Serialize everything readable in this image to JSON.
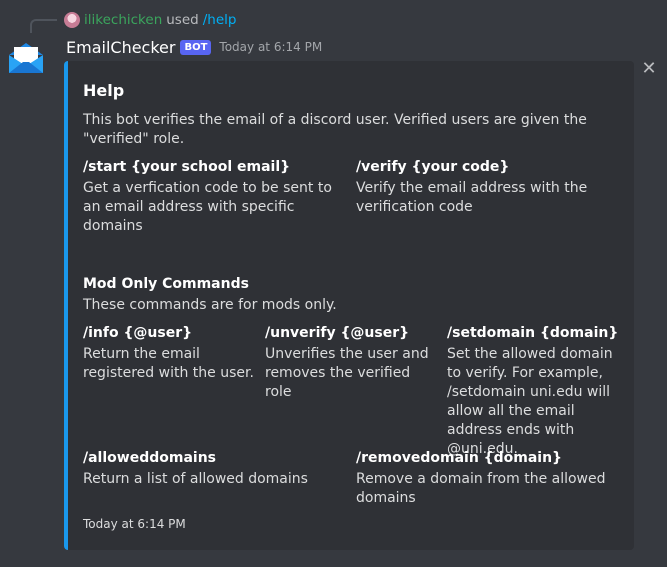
{
  "reply": {
    "username": "ilikechicken",
    "used": "used",
    "command": "/help"
  },
  "message": {
    "author": "EmailChecker",
    "bot_tag": "BOT",
    "timestamp": "Today at 6:14 PM"
  },
  "embed": {
    "accent_color": "#1a98ec",
    "title": "Help",
    "description": "This bot verifies the email of a discord user. Verified users are given the \"verified\" role.",
    "fields": [
      {
        "name": "/start {your school email}",
        "value": "Get a verfication code to be sent to an email address with specific domains"
      },
      {
        "name": "/verify {your code}",
        "value": "Verify the email address with the verification code"
      },
      {
        "name": "Mod Only Commands",
        "value": "These commands are for mods only."
      },
      {
        "name": "/info {@user}",
        "value": "Return the email registered with the user."
      },
      {
        "name": "/unverify {@user}",
        "value": "Unverifies the user and removes the verified role"
      },
      {
        "name": "/setdomain {domain}",
        "value": "Set the allowed domain to verify. For example, /setdomain uni.edu will allow all the email address ends with @uni.edu."
      },
      {
        "name": "/alloweddomains",
        "value": "Return a list of allowed domains"
      },
      {
        "name": "/removedomain {domain}",
        "value": "Remove a domain from the allowed domains"
      }
    ],
    "footer": "Today at 6:14 PM"
  },
  "icons": {
    "close": "close-icon",
    "avatar": "envelope-icon"
  }
}
